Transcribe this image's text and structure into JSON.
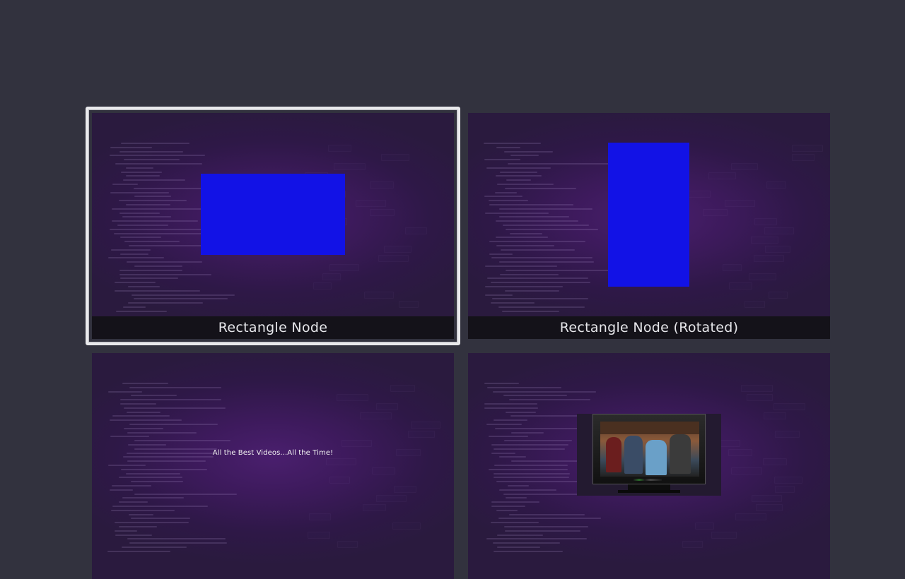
{
  "tiles": [
    {
      "caption": "Rectangle Node"
    },
    {
      "caption": "Rectangle Node (Rotated)"
    },
    {
      "caption": "",
      "tagline": "All the Best Videos...All the Time!"
    },
    {
      "caption": ""
    }
  ],
  "colors": {
    "page_background": "#32323e",
    "tile_background": "#2a1a3e",
    "rectangle_fill": "#1212e6",
    "caption_background": "#141219",
    "focus_ring": "#e9e9ec"
  },
  "focused_tile_index": 0
}
